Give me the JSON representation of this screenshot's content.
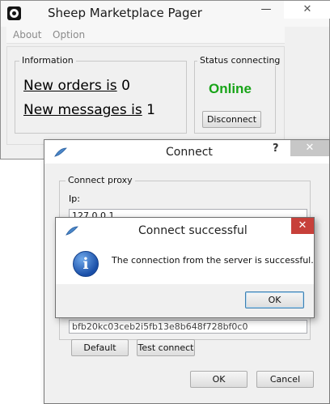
{
  "pager": {
    "title": "Sheep Marketplace Pager",
    "min_glyph": "—",
    "close_glyph": "✕",
    "menu": [
      {
        "label": "About"
      },
      {
        "label": "Option"
      }
    ],
    "info_group_label": "Information",
    "orders_label": "New orders is",
    "orders_count": "0",
    "messages_label": "New messages is",
    "messages_count": "1",
    "status_group_label": "Status connecting",
    "status_value": "Online",
    "disconnect_label": "Disconnect",
    "colors": {
      "online": "#18a418"
    }
  },
  "connect": {
    "title": "Connect",
    "help_glyph": "?",
    "close_glyph": "✕",
    "proxy_group_label": "Connect proxy",
    "ip_label": "Ip:",
    "ip_value": "127.0.0.1",
    "key_value": "bfb20kc03ceb2i5fb13e8b648f728bf0c0",
    "default_label": "Default",
    "test_connect_label": "Test connect",
    "ok_label": "OK",
    "cancel_label": "Cancel"
  },
  "message_box": {
    "title": "Connect successful",
    "close_glyph": "✕",
    "icon": "information-icon",
    "icon_glyph": "i",
    "text": "The connection from the server is successful.",
    "ok_label": "OK"
  }
}
